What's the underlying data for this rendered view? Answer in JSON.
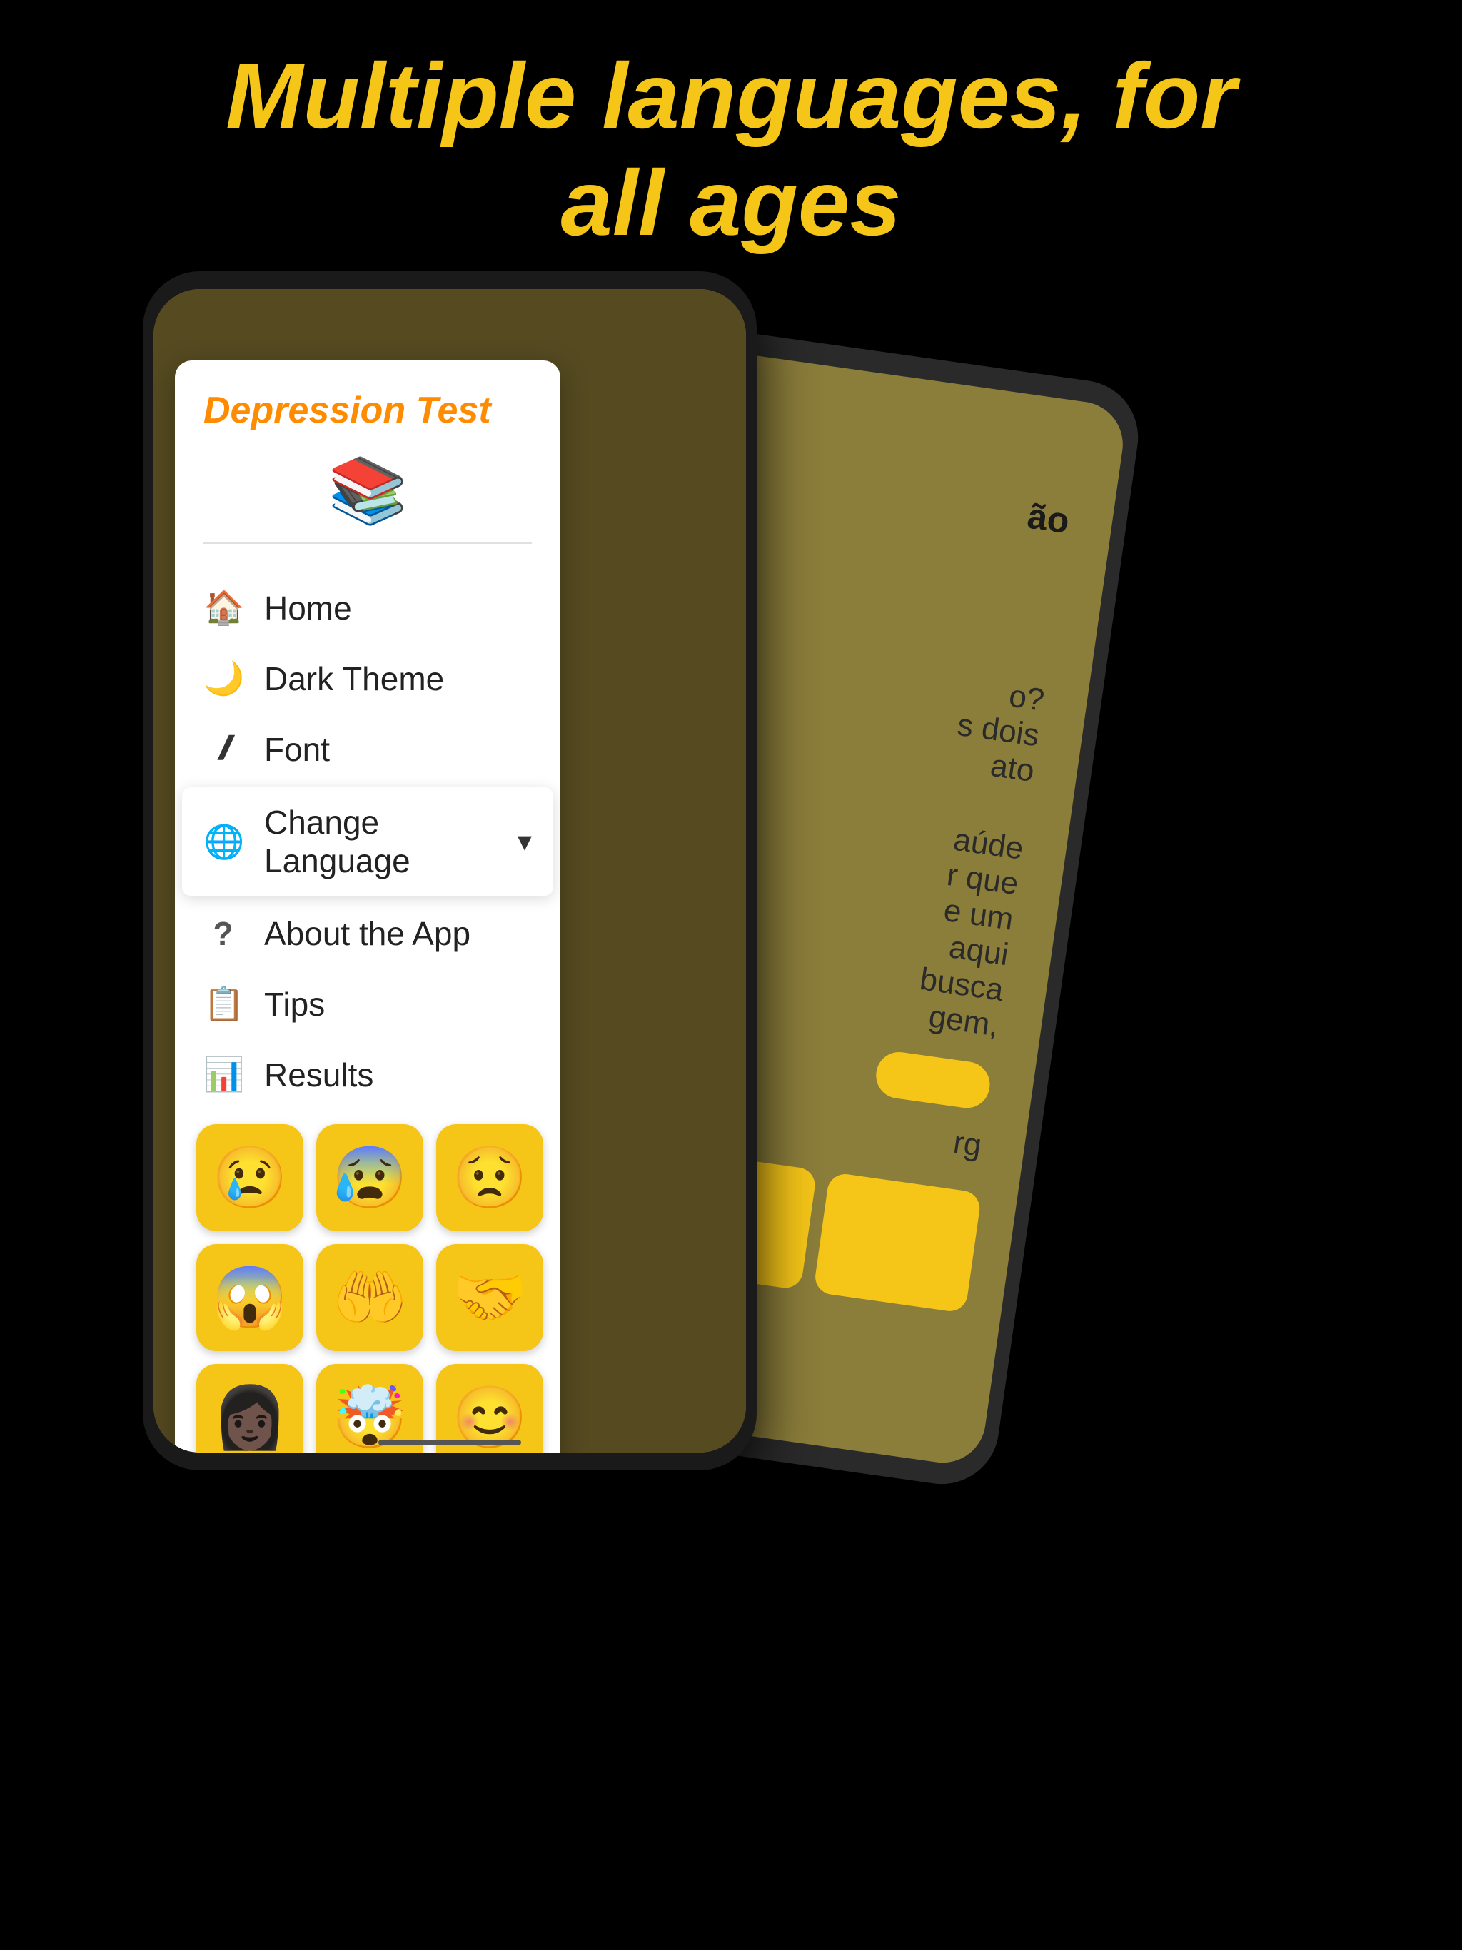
{
  "hero": {
    "title_line1": "Multiple languages, for",
    "title_line2": "all ages"
  },
  "colors": {
    "title_color": "#F5C518",
    "background": "#000000",
    "drawer_bg": "#ffffff",
    "accent_orange": "#FF8C00",
    "accent_yellow": "#F5C518",
    "phone_bg": "#1a1a1a",
    "screen_bg": "#7A6B2E"
  },
  "drawer": {
    "app_title": "Depression Test",
    "app_icon": "📚",
    "menu_items": [
      {
        "id": "home",
        "label": "Home",
        "icon": "🏠",
        "icon_type": "home"
      },
      {
        "id": "dark-theme",
        "label": "Dark Theme",
        "icon": "🌙",
        "icon_type": "moon"
      },
      {
        "id": "font",
        "label": "Font",
        "icon": "𝑰",
        "icon_type": "font"
      },
      {
        "id": "change-language",
        "label": "Change Language",
        "icon": "🌐",
        "icon_type": "globe",
        "has_chevron": true
      },
      {
        "id": "about",
        "label": "About the App",
        "icon": "?",
        "icon_type": "question"
      },
      {
        "id": "tips",
        "label": "Tips",
        "icon": "📋",
        "icon_type": "tips"
      },
      {
        "id": "results",
        "label": "Results",
        "icon": "📊",
        "icon_type": "results"
      }
    ],
    "chevron_label": "▾",
    "emotions": [
      "😢",
      "😰",
      "😟",
      "😱",
      "🤲",
      "🤝",
      "👩🏿",
      "🤯",
      "😊"
    ]
  },
  "back_phone": {
    "visible_text": [
      "ão",
      "o?",
      "s dois",
      "ato",
      "aúde",
      "r que",
      "e um",
      "aqui",
      "busca",
      "gem,",
      "rg"
    ],
    "yellow_button": true
  }
}
